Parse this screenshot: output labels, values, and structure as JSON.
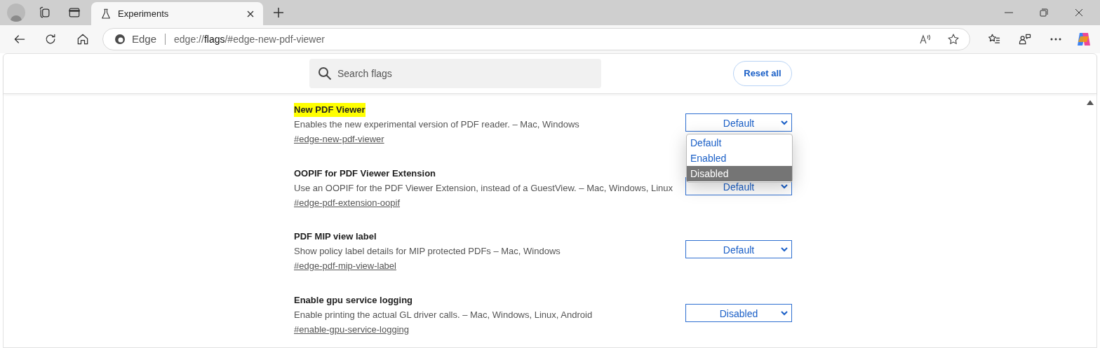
{
  "tab": {
    "title": "Experiments",
    "selected": true
  },
  "address_bar": {
    "site_label": "Edge",
    "url_parts": [
      {
        "text": "edge://",
        "emphasis": false
      },
      {
        "text": "flags",
        "emphasis": true
      },
      {
        "text": "/#edge-new-pdf-viewer",
        "emphasis": false
      }
    ]
  },
  "search": {
    "placeholder": "Search flags"
  },
  "reset_button": "Reset all",
  "flags": [
    {
      "title": "New PDF Viewer",
      "highlighted": true,
      "description": "Enables the new experimental version of PDF reader. – Mac, Windows",
      "anchor": "#edge-new-pdf-viewer",
      "value": "Default"
    },
    {
      "title": "OOPIF for PDF Viewer Extension",
      "highlighted": false,
      "description": "Use an OOPIF for the PDF Viewer Extension, instead of a GuestView. – Mac, Windows, Linux",
      "anchor": "#edge-pdf-extension-oopif",
      "value": "Default"
    },
    {
      "title": "PDF MIP view label",
      "highlighted": false,
      "description": "Show policy label details for MIP protected PDFs – Mac, Windows",
      "anchor": "#edge-pdf-mip-view-label",
      "value": "Default"
    },
    {
      "title": "Enable gpu service logging",
      "highlighted": false,
      "description": "Enable printing the actual GL driver calls. – Mac, Windows, Linux, Android",
      "anchor": "#enable-gpu-service-logging",
      "value": "Disabled"
    }
  ],
  "dropdown": {
    "options": [
      {
        "label": "Default",
        "selected": false
      },
      {
        "label": "Enabled",
        "selected": false
      },
      {
        "label": "Disabled",
        "selected": true
      }
    ]
  }
}
